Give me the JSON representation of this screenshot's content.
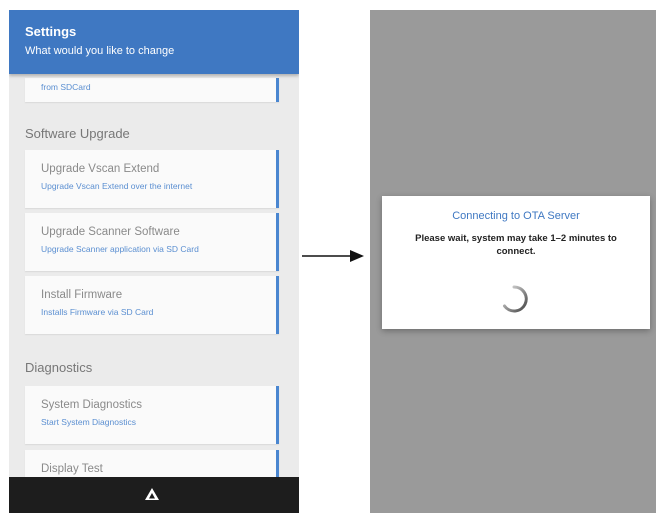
{
  "header": {
    "title": "Settings",
    "subtitle": "What would you like to change"
  },
  "top_partial_card": {
    "subtitle": "from SDCard"
  },
  "sections": {
    "software_upgrade": "Software Upgrade",
    "diagnostics": "Diagnostics"
  },
  "items": {
    "upgrade_vscan": {
      "title": "Upgrade Vscan Extend",
      "subtitle": "Upgrade Vscan Extend over the internet"
    },
    "upgrade_scanner": {
      "title": "Upgrade Scanner Software",
      "subtitle": "Upgrade Scanner application via SD Card"
    },
    "install_firmware": {
      "title": "Install Firmware",
      "subtitle": "Installs Firmware via SD Card"
    },
    "system_diagnostics": {
      "title": "System Diagnostics",
      "subtitle": "Start System Diagnostics"
    },
    "display_test": {
      "title": "Display Test"
    }
  },
  "dialog": {
    "title": "Connecting to OTA Server",
    "message": "Please wait, system may take 1–2 minutes to connect."
  },
  "icons": {
    "nav": "home-icon",
    "spinner": "loading-spinner-icon",
    "arrow": "right-arrow-icon"
  },
  "colors": {
    "accent": "#3f78c2",
    "card_border": "#4a86d0",
    "nav_bar": "#1d1d1d",
    "overlay": "#9a9a9a"
  }
}
